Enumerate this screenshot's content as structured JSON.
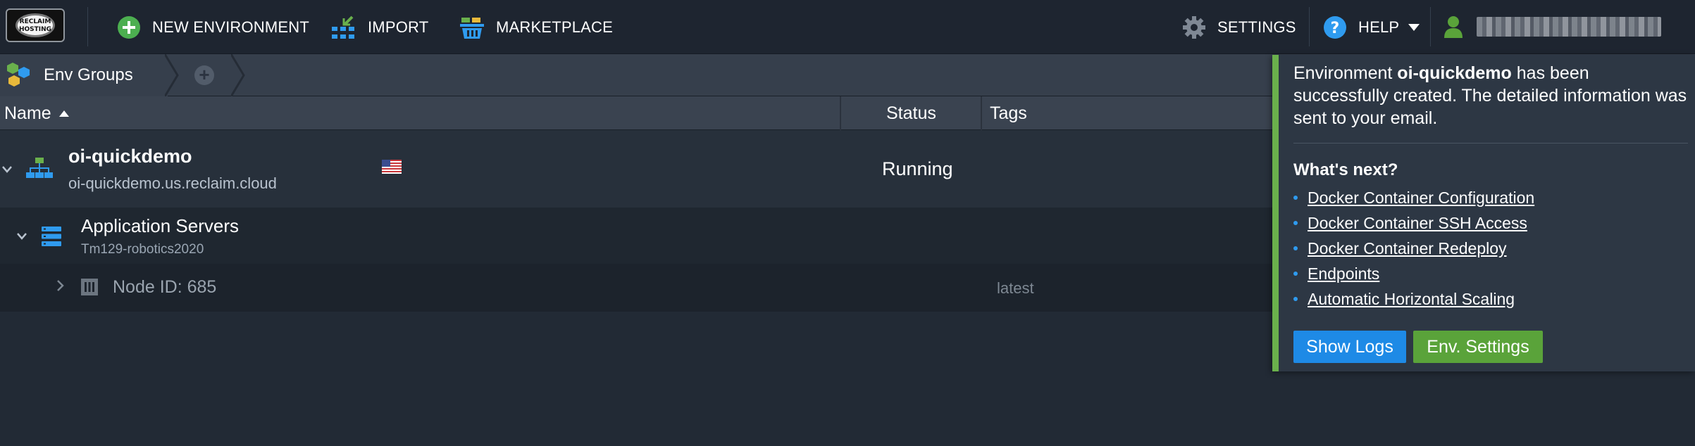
{
  "toolbar": {
    "logo_text": "RECLAIM HOSTING",
    "new_environment": "NEW ENVIRONMENT",
    "import": "IMPORT",
    "marketplace": "MARKETPLACE",
    "settings": "SETTINGS",
    "help": "HELP"
  },
  "groups": {
    "label": "Env Groups"
  },
  "table": {
    "col_name": "Name",
    "col_status": "Status",
    "col_tags": "Tags"
  },
  "environment": {
    "name": "oi-quickdemo",
    "domain": "oi-quickdemo.us.reclaim.cloud",
    "status": "Running",
    "region_flag": "us-flag"
  },
  "app_servers": {
    "name": "Application Servers",
    "subtitle": "Tm129-robotics2020"
  },
  "node": {
    "label": "Node ID: 685",
    "tag": "latest"
  },
  "popup": {
    "msg_prefix": "Environment ",
    "msg_env": "oi-quickdemo",
    "msg_suffix": " has been successfully created. The detailed information was sent to your email.",
    "whats_next": "What's next?",
    "links": [
      "Docker Container Configuration",
      "Docker Container SSH Access",
      "Docker Container Redeploy",
      "Endpoints",
      "Automatic Horizontal Scaling"
    ],
    "show_logs": "Show Logs",
    "env_settings": "Env. Settings"
  },
  "colors": {
    "accent_green": "#6ab04c",
    "button_blue": "#1e8ae6",
    "button_green": "#5aa33a",
    "help_blue": "#2f9bef"
  }
}
